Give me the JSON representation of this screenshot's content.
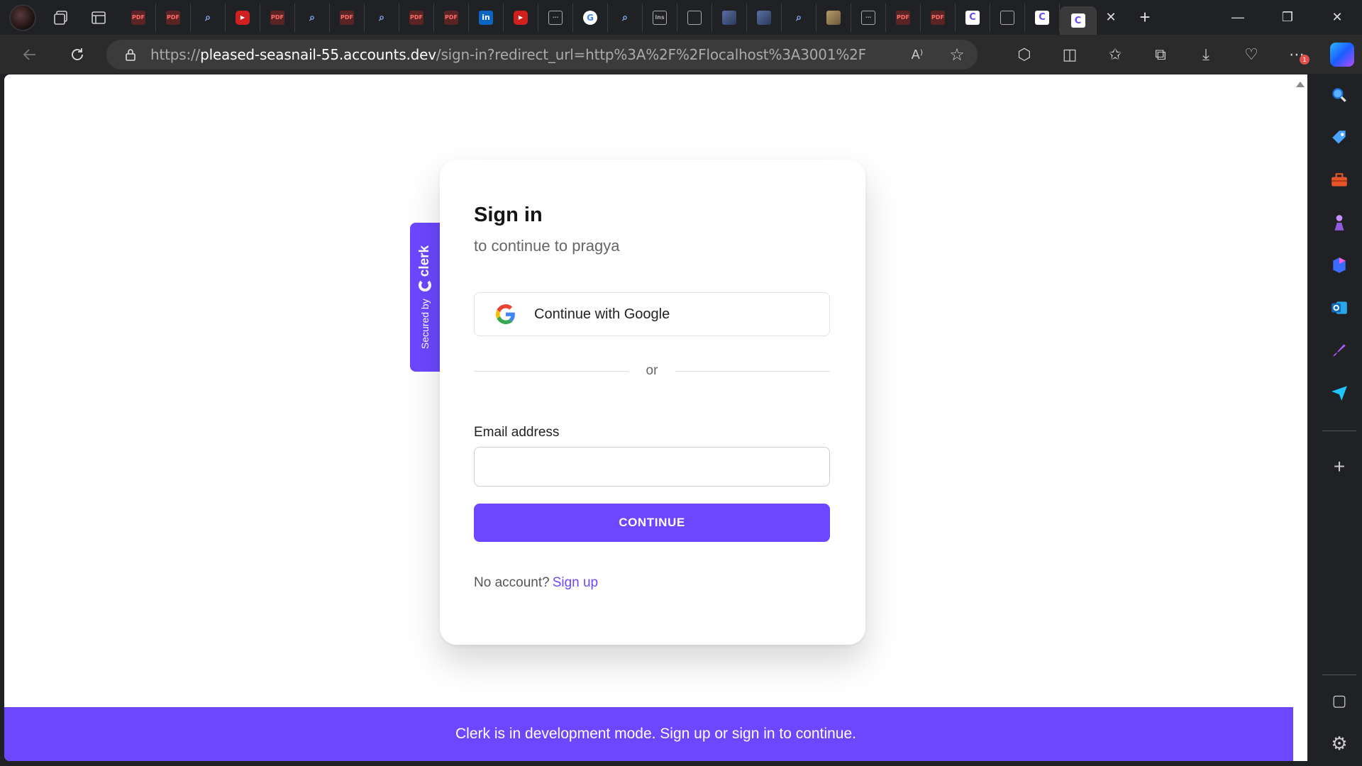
{
  "browser": {
    "tabs": [
      {
        "kind": "pdf",
        "glyph": "PDF"
      },
      {
        "kind": "pdf",
        "glyph": "PDF"
      },
      {
        "kind": "search",
        "glyph": "⌕"
      },
      {
        "kind": "yt",
        "glyph": "▶"
      },
      {
        "kind": "pdf",
        "glyph": "PDF"
      },
      {
        "kind": "search",
        "glyph": "⌕"
      },
      {
        "kind": "pdf",
        "glyph": "PDF"
      },
      {
        "kind": "search",
        "glyph": "⌕"
      },
      {
        "kind": "pdf",
        "glyph": "PDF"
      },
      {
        "kind": "pdf",
        "glyph": "PDF"
      },
      {
        "kind": "li",
        "glyph": "in"
      },
      {
        "kind": "yt",
        "glyph": "▶"
      },
      {
        "kind": "gen",
        "glyph": "⋯"
      },
      {
        "kind": "g",
        "glyph": "G"
      },
      {
        "kind": "search",
        "glyph": "⌕"
      },
      {
        "kind": "gen",
        "glyph": "ins"
      },
      {
        "kind": "gen",
        "glyph": ""
      },
      {
        "kind": "img",
        "glyph": ""
      },
      {
        "kind": "img",
        "glyph": ""
      },
      {
        "kind": "search",
        "glyph": "⌕"
      },
      {
        "kind": "sand",
        "glyph": ""
      },
      {
        "kind": "gen",
        "glyph": "⋯"
      },
      {
        "kind": "pdf",
        "glyph": "PDF"
      },
      {
        "kind": "pdf",
        "glyph": "PDF"
      },
      {
        "kind": "clerk",
        "glyph": "C"
      },
      {
        "kind": "gen",
        "glyph": ""
      },
      {
        "kind": "clerk",
        "glyph": "C"
      }
    ],
    "active_tab_glyph": "C",
    "close_tab_glyph": "✕",
    "new_tab_glyph": "+",
    "window_controls": {
      "minimize": "—",
      "restore": "❐",
      "close": "✕"
    },
    "url": {
      "scheme": "https://",
      "host": "pleased-seasnail-55.accounts.dev",
      "path": "/sign-in?redirect_url=http%3A%2F%2Flocalhost%3A3001%2F"
    },
    "toolbar_icons": {
      "read_aloud": "A⁾",
      "favorite": "☆",
      "extensions": "⬡",
      "split": "◫",
      "favorites": "✩",
      "collections": "⧉",
      "downloads": "⤓",
      "health": "♡",
      "more": "⋯",
      "more_badge": "1"
    }
  },
  "page": {
    "secured_by": "Secured by",
    "clerk_brand": "clerk",
    "title": "Sign in",
    "subtitle": "to continue to pragya",
    "google_button": "Continue with Google",
    "divider_text": "or",
    "email_label": "Email address",
    "email_value": "",
    "continue_button": "CONTINUE",
    "no_account": "No account?",
    "sign_up": "Sign up",
    "dev_banner": "Clerk is in development mode. Sign up or sign in to continue."
  },
  "sidebar": {
    "icons": [
      "search-icon",
      "shopping-tag-icon",
      "toolbox-icon",
      "games-icon",
      "copilot-icon",
      "outlook-icon",
      "designer-icon",
      "send-icon"
    ],
    "add": "+",
    "panel": "▢",
    "settings": "⚙"
  },
  "colors": {
    "accent": "#6c47ff",
    "browser_bg": "#202124",
    "toolbar_bg": "#2b2b2b"
  }
}
